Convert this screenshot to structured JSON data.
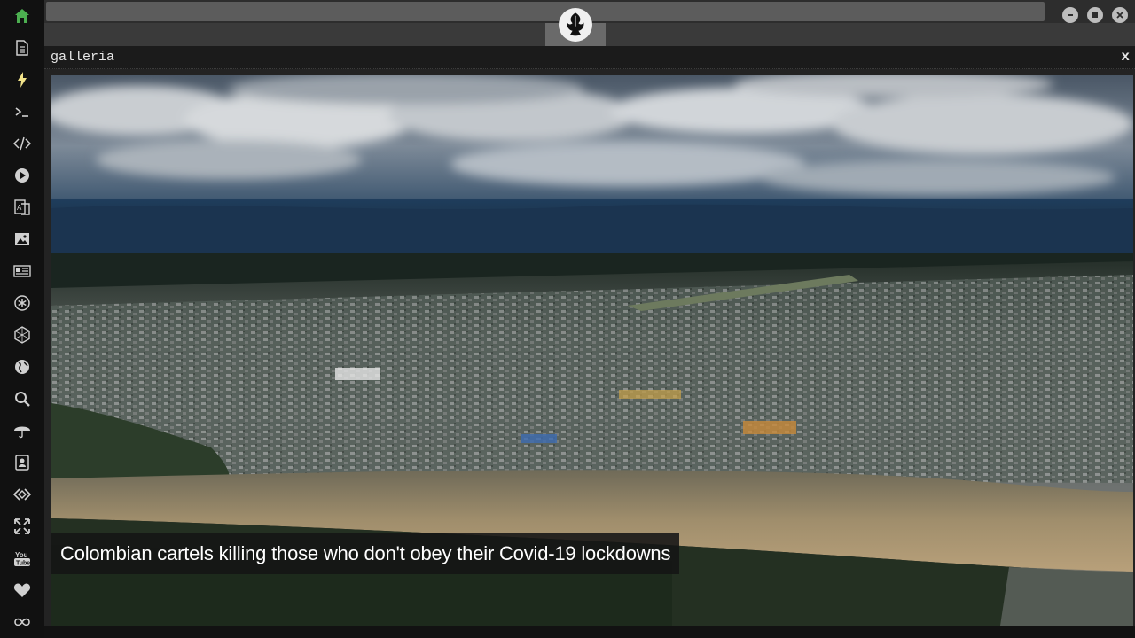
{
  "panel": {
    "title": "galleria",
    "close_label": "x"
  },
  "caption": {
    "text": "Colombian cartels killing those who don't obey their Covid-19 lockdowns"
  },
  "sidebar": {
    "items": [
      {
        "icon": "home-icon",
        "active": true
      },
      {
        "icon": "document-icon"
      },
      {
        "icon": "lightning-icon",
        "accent": true
      },
      {
        "icon": "terminal-icon"
      },
      {
        "icon": "code-icon"
      },
      {
        "icon": "play-icon"
      },
      {
        "icon": "translate-icon"
      },
      {
        "icon": "image-icon"
      },
      {
        "icon": "news-icon"
      },
      {
        "icon": "asterisk-circle-icon"
      },
      {
        "icon": "hexagon-icon"
      },
      {
        "icon": "globe-icon"
      },
      {
        "icon": "search-icon"
      },
      {
        "icon": "umbrella-icon"
      },
      {
        "icon": "contact-icon"
      },
      {
        "icon": "code-diamond-icon"
      },
      {
        "icon": "expand-icon"
      },
      {
        "icon": "youtube-icon"
      },
      {
        "icon": "heart-icon"
      },
      {
        "icon": "infinity-icon"
      }
    ]
  },
  "colors": {
    "accent_green": "#4caf50",
    "accent_yellow": "#f2e38a",
    "sidebar_bg": "#111111",
    "icon_default": "#d0d0d0"
  }
}
